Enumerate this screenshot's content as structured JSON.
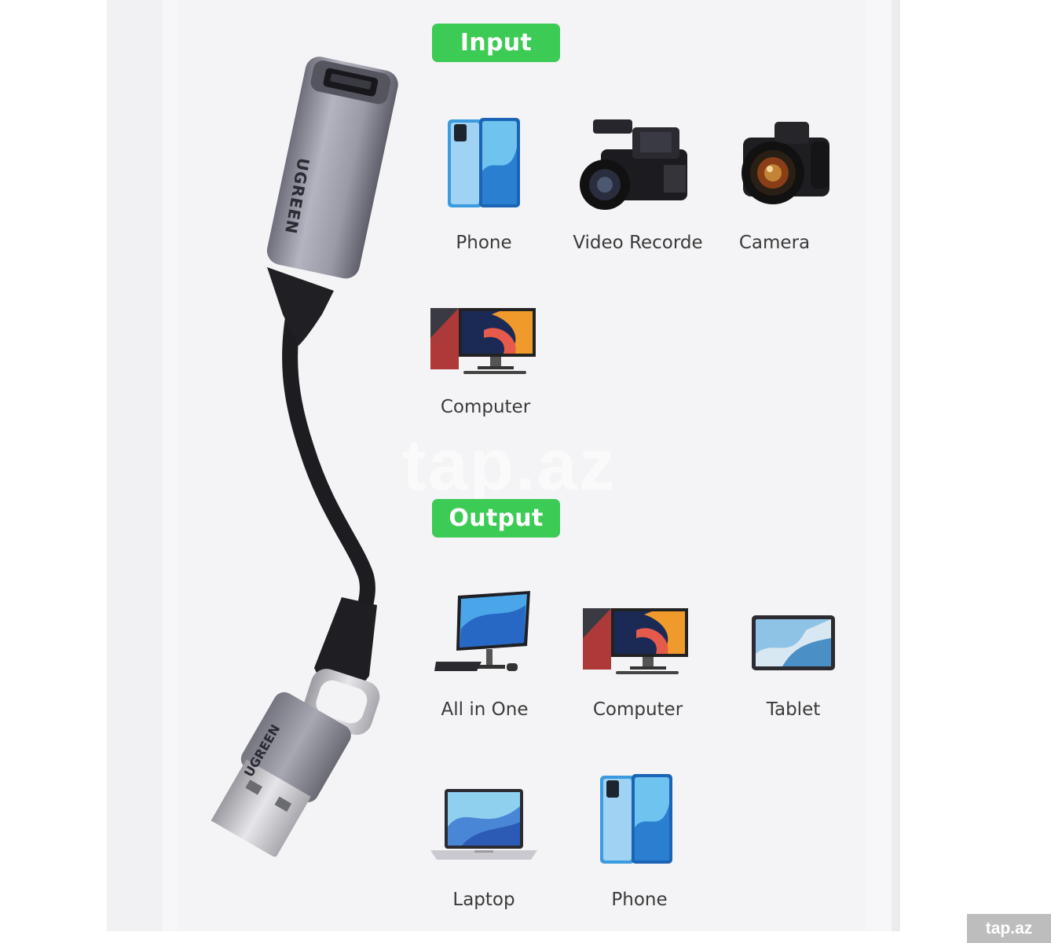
{
  "input": {
    "heading": "Input",
    "devices": [
      {
        "label": "Phone",
        "icon": "phone-icon"
      },
      {
        "label": "Video Recorde",
        "icon": "video-recorder-icon"
      },
      {
        "label": "Camera",
        "icon": "camera-icon"
      },
      {
        "label": "Computer",
        "icon": "computer-icon"
      }
    ]
  },
  "output": {
    "heading": "Output",
    "devices": [
      {
        "label": "All in One",
        "icon": "all-in-one-icon"
      },
      {
        "label": "Computer",
        "icon": "computer-icon"
      },
      {
        "label": "Tablet",
        "icon": "tablet-icon"
      },
      {
        "label": "Laptop",
        "icon": "laptop-icon"
      },
      {
        "label": "Phone",
        "icon": "phone-icon"
      }
    ]
  },
  "product": {
    "brand_top": "UGREEN",
    "brand_bottom": "UGREEN"
  },
  "watermark": "tap.az",
  "site_badge": "tap.az",
  "colors": {
    "accent_green": "#3ccb55",
    "panel_bg": "#f4f4f6",
    "text": "#3a3a3a"
  }
}
